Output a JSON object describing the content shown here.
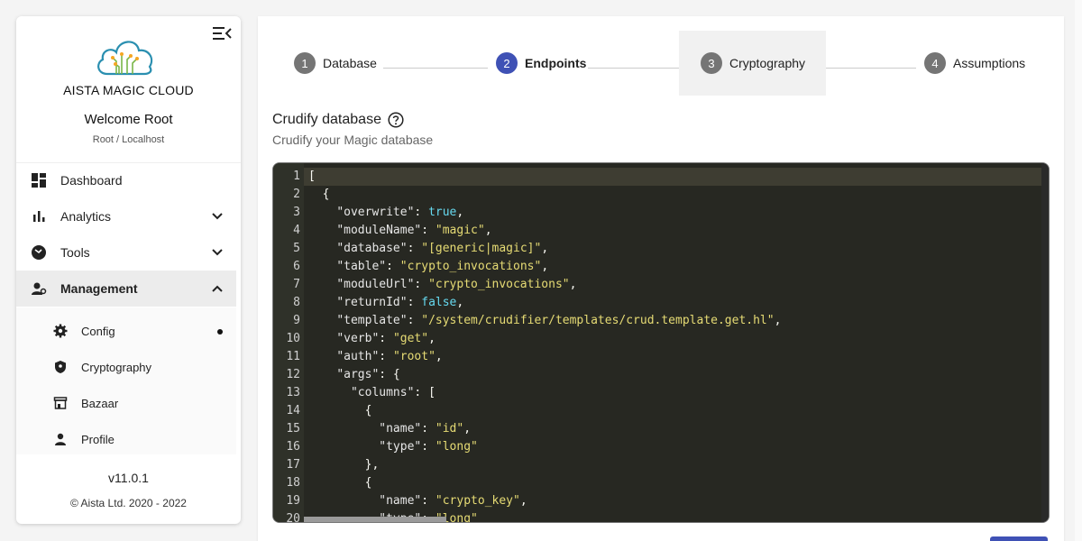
{
  "app": {
    "brand": "AISTA MAGIC CLOUD",
    "welcome": "Welcome Root",
    "user_context": "Root / Localhost",
    "version": "v11.0.1",
    "copyright": "© Aista Ltd. 2020 - 2022",
    "accent_color": "#3f51b5"
  },
  "sidebar": {
    "items": [
      {
        "label": "Dashboard",
        "icon": "dashboard-icon"
      },
      {
        "label": "Analytics",
        "icon": "bar-chart-icon",
        "expandable": true
      },
      {
        "label": "Tools",
        "icon": "tools-icon",
        "expandable": true
      },
      {
        "label": "Management",
        "icon": "manage-accounts-icon",
        "expanded": true
      }
    ],
    "subitems": [
      {
        "label": "Config",
        "icon": "gear-icon"
      },
      {
        "label": "Cryptography",
        "icon": "shield-icon"
      },
      {
        "label": "Bazaar",
        "icon": "store-icon"
      },
      {
        "label": "Profile",
        "icon": "person-icon"
      }
    ]
  },
  "stepper": {
    "steps": [
      {
        "num": "1",
        "label": "Database"
      },
      {
        "num": "2",
        "label": "Endpoints"
      },
      {
        "num": "3",
        "label": "Cryptography"
      },
      {
        "num": "4",
        "label": "Assumptions"
      }
    ],
    "active": "2"
  },
  "section": {
    "title": "Crudify database",
    "subtitle": "Crudify your Magic database"
  },
  "editor": {
    "lines": [
      [
        {
          "t": "[",
          "c": "p"
        }
      ],
      [
        {
          "t": "  {",
          "c": "p"
        }
      ],
      [
        {
          "t": "    ",
          "c": "p"
        },
        {
          "t": "\"overwrite\"",
          "c": "k"
        },
        {
          "t": ": ",
          "c": "p"
        },
        {
          "t": "true",
          "c": "b"
        },
        {
          "t": ",",
          "c": "p"
        }
      ],
      [
        {
          "t": "    ",
          "c": "p"
        },
        {
          "t": "\"moduleName\"",
          "c": "k"
        },
        {
          "t": ": ",
          "c": "p"
        },
        {
          "t": "\"magic\"",
          "c": "s"
        },
        {
          "t": ",",
          "c": "p"
        }
      ],
      [
        {
          "t": "    ",
          "c": "p"
        },
        {
          "t": "\"database\"",
          "c": "k"
        },
        {
          "t": ": ",
          "c": "p"
        },
        {
          "t": "\"[generic|magic]\"",
          "c": "s"
        },
        {
          "t": ",",
          "c": "p"
        }
      ],
      [
        {
          "t": "    ",
          "c": "p"
        },
        {
          "t": "\"table\"",
          "c": "k"
        },
        {
          "t": ": ",
          "c": "p"
        },
        {
          "t": "\"crypto_invocations\"",
          "c": "s"
        },
        {
          "t": ",",
          "c": "p"
        }
      ],
      [
        {
          "t": "    ",
          "c": "p"
        },
        {
          "t": "\"moduleUrl\"",
          "c": "k"
        },
        {
          "t": ": ",
          "c": "p"
        },
        {
          "t": "\"crypto_invocations\"",
          "c": "s"
        },
        {
          "t": ",",
          "c": "p"
        }
      ],
      [
        {
          "t": "    ",
          "c": "p"
        },
        {
          "t": "\"returnId\"",
          "c": "k"
        },
        {
          "t": ": ",
          "c": "p"
        },
        {
          "t": "false",
          "c": "b"
        },
        {
          "t": ",",
          "c": "p"
        }
      ],
      [
        {
          "t": "    ",
          "c": "p"
        },
        {
          "t": "\"template\"",
          "c": "k"
        },
        {
          "t": ": ",
          "c": "p"
        },
        {
          "t": "\"/system/crudifier/templates/crud.template.get.hl\"",
          "c": "s"
        },
        {
          "t": ",",
          "c": "p"
        }
      ],
      [
        {
          "t": "    ",
          "c": "p"
        },
        {
          "t": "\"verb\"",
          "c": "k"
        },
        {
          "t": ": ",
          "c": "p"
        },
        {
          "t": "\"get\"",
          "c": "s"
        },
        {
          "t": ",",
          "c": "p"
        }
      ],
      [
        {
          "t": "    ",
          "c": "p"
        },
        {
          "t": "\"auth\"",
          "c": "k"
        },
        {
          "t": ": ",
          "c": "p"
        },
        {
          "t": "\"root\"",
          "c": "s"
        },
        {
          "t": ",",
          "c": "p"
        }
      ],
      [
        {
          "t": "    ",
          "c": "p"
        },
        {
          "t": "\"args\"",
          "c": "k"
        },
        {
          "t": ": {",
          "c": "p"
        }
      ],
      [
        {
          "t": "      ",
          "c": "p"
        },
        {
          "t": "\"columns\"",
          "c": "k"
        },
        {
          "t": ": [",
          "c": "p"
        }
      ],
      [
        {
          "t": "        {",
          "c": "p"
        }
      ],
      [
        {
          "t": "          ",
          "c": "p"
        },
        {
          "t": "\"name\"",
          "c": "k"
        },
        {
          "t": ": ",
          "c": "p"
        },
        {
          "t": "\"id\"",
          "c": "s"
        },
        {
          "t": ",",
          "c": "p"
        }
      ],
      [
        {
          "t": "          ",
          "c": "p"
        },
        {
          "t": "\"type\"",
          "c": "k"
        },
        {
          "t": ": ",
          "c": "p"
        },
        {
          "t": "\"long\"",
          "c": "s"
        }
      ],
      [
        {
          "t": "        },",
          "c": "p"
        }
      ],
      [
        {
          "t": "        {",
          "c": "p"
        }
      ],
      [
        {
          "t": "          ",
          "c": "p"
        },
        {
          "t": "\"name\"",
          "c": "k"
        },
        {
          "t": ": ",
          "c": "p"
        },
        {
          "t": "\"crypto_key\"",
          "c": "s"
        },
        {
          "t": ",",
          "c": "p"
        }
      ],
      [
        {
          "t": "          ",
          "c": "p"
        },
        {
          "t": "\"type\"",
          "c": "k"
        },
        {
          "t": ": ",
          "c": "p"
        },
        {
          "t": "\"long\"",
          "c": "s"
        }
      ]
    ]
  }
}
